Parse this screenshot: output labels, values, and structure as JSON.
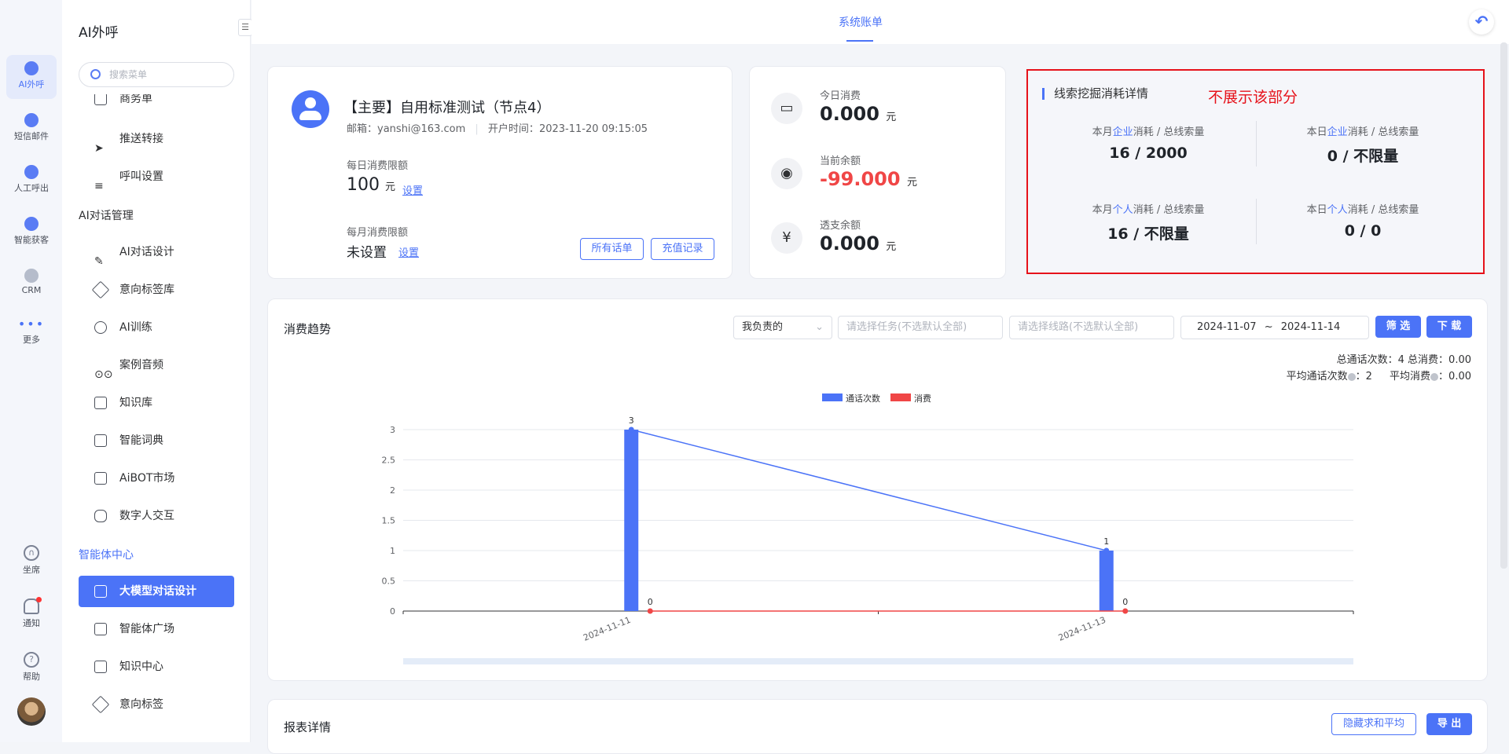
{
  "rail": {
    "items": [
      {
        "label": "AI外呼",
        "active": true
      },
      {
        "label": "短信邮件"
      },
      {
        "label": "人工呼出"
      },
      {
        "label": "智能获客"
      },
      {
        "label": "CRM"
      },
      {
        "label": "更多"
      }
    ],
    "bottom": [
      {
        "label": "坐席"
      },
      {
        "label": "通知"
      },
      {
        "label": "帮助"
      }
    ]
  },
  "menu": {
    "title": "AI外呼",
    "search_placeholder": "搜索菜单",
    "items_top": [
      "商务单",
      "推送转接",
      "呼叫设置"
    ],
    "group1": "AI对话管理",
    "group1_items": [
      "AI对话设计",
      "意向标签库",
      "AI训练",
      "案例音频",
      "知识库",
      "智能词典",
      "AiBOT市场",
      "数字人交互"
    ],
    "group2": "智能体中心",
    "group2_items": [
      "大模型对话设计",
      "智能体广场",
      "知识中心",
      "意向标签"
    ]
  },
  "topbar": {
    "tab": "系统账单"
  },
  "account": {
    "name": "【主要】自用标准测试（节点4）",
    "email_label": "邮箱：",
    "email": "yanshi@163.com",
    "open_time_label": "开户时间：",
    "open_time": "2023-11-20 09:15:05",
    "daily_limit_label": "每日消费限额",
    "daily_limit_value": "100",
    "unit": "元",
    "set_link": "设置",
    "monthly_limit_label": "每月消费限额",
    "monthly_limit_value": "未设置",
    "btn_all_bills": "所有话单",
    "btn_recharge": "充值记录"
  },
  "money": {
    "today_label": "今日消费",
    "today_value": "0.000",
    "balance_label": "当前余额",
    "balance_value": "-99.000",
    "overdraft_label": "透支余额",
    "overdraft_value": "0.000",
    "unit": "元"
  },
  "detail": {
    "title": "线索挖掘消耗详情",
    "note": "不展示该部分",
    "stats": [
      {
        "pre": "本月",
        "hl": "企业",
        "post": "消耗 / 总线索量",
        "value": "16 / 2000"
      },
      {
        "pre": "本日",
        "hl": "企业",
        "post": "消耗 / 总线索量",
        "value": "0 / 不限量"
      },
      {
        "pre": "本月",
        "hl": "个人",
        "post": "消耗 / 总线索量",
        "value": "16 / 不限量"
      },
      {
        "pre": "本日",
        "hl": "个人",
        "post": "消耗 / 总线索量",
        "value": "0 / 0"
      }
    ]
  },
  "trend": {
    "title": "消费趋势",
    "owner_select": "我负责的",
    "task_placeholder": "请选择任务(不选默认全部)",
    "line_placeholder": "请选择线路(不选默认全部)",
    "date_start": "2024-11-07",
    "date_sep": "~",
    "date_end": "2024-11-14",
    "btn_filter": "筛 选",
    "btn_download": "下 载",
    "summary_line1": "总通话次数：4   总消费：0.00",
    "summary_avg_calls_label": "平均通话次数",
    "summary_avg_calls": "：2",
    "summary_avg_cost_label": "平均消费",
    "summary_avg_cost": "：0.00"
  },
  "report": {
    "title": "报表详情",
    "btn_hide": "隐藏求和平均",
    "btn_export": "导 出"
  },
  "chart_data": {
    "type": "bar",
    "categories": [
      "2024-11-11",
      "2024-11-13"
    ],
    "series": [
      {
        "name": "通话次数",
        "type": "bar+line",
        "values": [
          3,
          1
        ],
        "color": "#4b73f7"
      },
      {
        "name": "消费",
        "type": "line",
        "values": [
          0,
          0
        ],
        "color": "#f04646"
      }
    ],
    "yticks": [
      "0",
      "0.5",
      "1",
      "1.5",
      "2",
      "2.5",
      "3"
    ],
    "ylim": [
      0,
      3
    ],
    "legend": "top-center",
    "grid": true
  }
}
